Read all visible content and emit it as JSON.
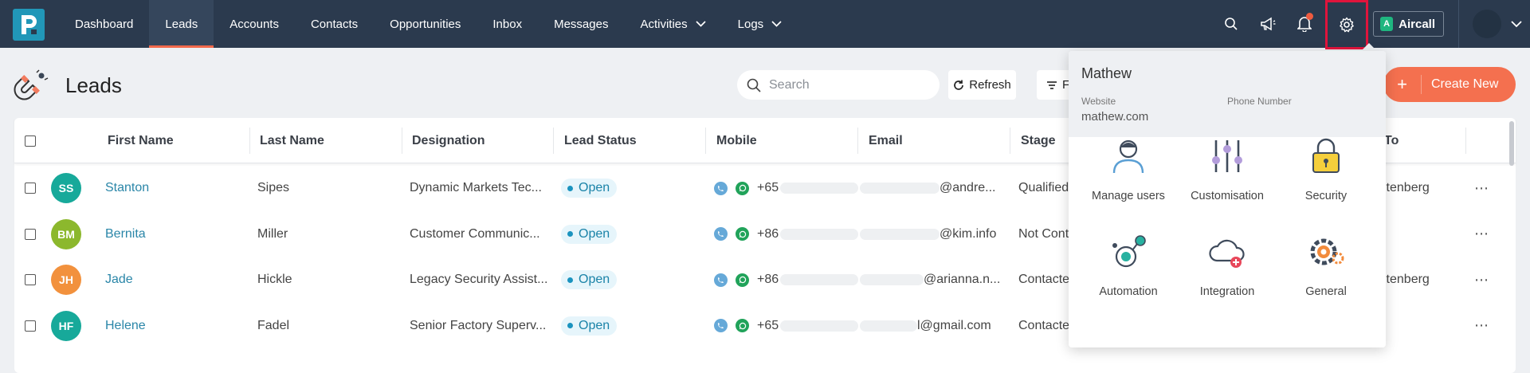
{
  "nav": {
    "items": [
      {
        "label": "Dashboard",
        "active": false,
        "dropdown": false
      },
      {
        "label": "Leads",
        "active": true,
        "dropdown": false
      },
      {
        "label": "Accounts",
        "active": false,
        "dropdown": false
      },
      {
        "label": "Contacts",
        "active": false,
        "dropdown": false
      },
      {
        "label": "Opportunities",
        "active": false,
        "dropdown": false
      },
      {
        "label": "Inbox",
        "active": false,
        "dropdown": false
      },
      {
        "label": "Messages",
        "active": false,
        "dropdown": false
      },
      {
        "label": "Activities",
        "active": false,
        "dropdown": true
      },
      {
        "label": "Logs",
        "active": false,
        "dropdown": true
      }
    ],
    "aircall_label": "Aircall",
    "logo_letter": "P",
    "aircall_letter": "A"
  },
  "page": {
    "title": "Leads",
    "search_placeholder": "Search",
    "refresh_label": "Refresh",
    "filter_label": "F",
    "create_label": "Create New",
    "create_plus": "+"
  },
  "table": {
    "columns": [
      "First Name",
      "Last Name",
      "Designation",
      "Lead Status",
      "Mobile",
      "Email",
      "Stage",
      "To"
    ],
    "rows": [
      {
        "initials": "SS",
        "avatar_color": "#17a99a",
        "first": "Stanton",
        "last": "Sipes",
        "designation": "Dynamic Markets Tec...",
        "status": "Open",
        "mobile": "+65",
        "email": "@andre...",
        "stage": "Qualified",
        "owner": "ltenberg"
      },
      {
        "initials": "BM",
        "avatar_color": "#8cb82d",
        "first": "Bernita",
        "last": "Miller",
        "designation": "Customer Communic...",
        "status": "Open",
        "mobile": "+86",
        "email": "@kim.info",
        "stage": "Not Cont",
        "owner": ""
      },
      {
        "initials": "JH",
        "avatar_color": "#f2913d",
        "first": "Jade",
        "last": "Hickle",
        "designation": "Legacy Security Assist...",
        "status": "Open",
        "mobile": "+86",
        "email": "@arianna.n...",
        "stage": "Contacte",
        "owner": "ltenberg"
      },
      {
        "initials": "HF",
        "avatar_color": "#17a99a",
        "first": "Helene",
        "last": "Fadel",
        "designation": "Senior Factory Superv...",
        "status": "Open",
        "mobile": "+65",
        "email": "l@gmail.com",
        "stage": "Contacte",
        "owner": ""
      }
    ],
    "more_label": "⋯"
  },
  "settings": {
    "user_name": "Mathew",
    "website_label": "Website",
    "website_value": "mathew.com",
    "phone_label": "Phone Number",
    "phone_value": "",
    "tiles": [
      {
        "label": "Manage users",
        "icon": "manage-users-icon"
      },
      {
        "label": "Customisation",
        "icon": "sliders-icon"
      },
      {
        "label": "Security",
        "icon": "lock-icon"
      },
      {
        "label": "Automation",
        "icon": "automation-icon"
      },
      {
        "label": "Integration",
        "icon": "cloud-integration-icon"
      },
      {
        "label": "General",
        "icon": "gear-settings-icon"
      }
    ]
  },
  "colors": {
    "nav_bg": "#2b3a4e",
    "accent": "#f4704f",
    "highlight_box": "#e0143c",
    "link": "#2a86a8"
  }
}
